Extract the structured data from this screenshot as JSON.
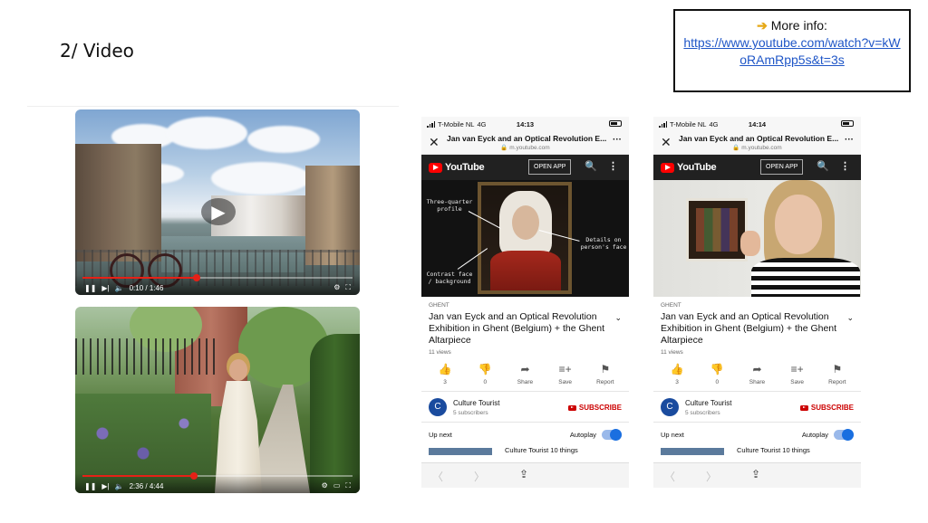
{
  "slide": {
    "title": "2/ Video",
    "info_label": "More info:",
    "info_url": "https://www.youtube.com/watch?v=kWoRAmRpp5s&t=3s"
  },
  "videos": [
    {
      "name": "ghent-canal",
      "time": "0:10 / 1:46"
    },
    {
      "name": "garden",
      "time": "2:36 / 4:44"
    }
  ],
  "phones": [
    {
      "carrier": "T-Mobile NL",
      "network": "4G",
      "time": "14:13",
      "page_title": "Jan van Eyck and an Optical Revolution E...",
      "domain": "m.youtube.com",
      "yt_logo": "YouTube",
      "open_app": "OPEN APP",
      "annotations": {
        "a1": "Three-quarter profile",
        "a2": "Details on person's face",
        "a3": "Contrast face / background"
      },
      "tag": "GHENT",
      "video_title": "Jan van Eyck and an Optical Revolution Exhibition in Ghent (Belgium) + the Ghent Altarpiece",
      "views": "11 views",
      "actions": [
        {
          "icon": "thumbs-up-icon",
          "label": "3"
        },
        {
          "icon": "thumbs-down-icon",
          "label": "0"
        },
        {
          "icon": "share-icon",
          "label": "Share"
        },
        {
          "icon": "save-icon",
          "label": "Save"
        },
        {
          "icon": "flag-icon",
          "label": "Report"
        }
      ],
      "channel_initial": "C",
      "channel": "Culture Tourist",
      "subscribers": "5 subscribers",
      "subscribe": "SUBSCRIBE",
      "up_next": "Up next",
      "autoplay": "Autoplay",
      "next_title": "Culture Tourist 10 things"
    },
    {
      "carrier": "T-Mobile NL",
      "network": "4G",
      "time": "14:14",
      "page_title": "Jan van Eyck and an Optical Revolution E...",
      "domain": "m.youtube.com",
      "yt_logo": "YouTube",
      "open_app": "OPEN APP",
      "tag": "GHENT",
      "video_title": "Jan van Eyck and an Optical Revolution Exhibition in Ghent (Belgium) + the Ghent Altarpiece",
      "views": "11 views",
      "actions": [
        {
          "icon": "thumbs-up-icon",
          "label": "3"
        },
        {
          "icon": "thumbs-down-icon",
          "label": "0"
        },
        {
          "icon": "share-icon",
          "label": "Share"
        },
        {
          "icon": "save-icon",
          "label": "Save"
        },
        {
          "icon": "flag-icon",
          "label": "Report"
        }
      ],
      "channel_initial": "C",
      "channel": "Culture Tourist",
      "subscribers": "5 subscribers",
      "subscribe": "SUBSCRIBE",
      "up_next": "Up next",
      "autoplay": "Autoplay",
      "next_title": "Culture Tourist 10 things"
    }
  ],
  "colors": {
    "youtube_red": "#ff0000",
    "subscribe_red": "#cc0000",
    "link_blue": "#1f56c7",
    "toggle_blue": "#1a6fe0"
  }
}
